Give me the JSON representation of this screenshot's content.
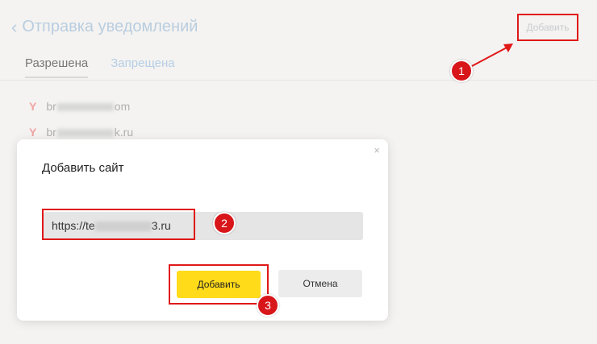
{
  "header": {
    "back_label": "Отправка уведомлений",
    "add_button": "Добавить"
  },
  "tabs": [
    {
      "label": "Разрешена",
      "active": true
    },
    {
      "label": "Запрещена",
      "active": false
    }
  ],
  "sites": [
    {
      "prefix": "br",
      "suffix": "om"
    },
    {
      "prefix": "br",
      "suffix": "k.ru"
    }
  ],
  "modal": {
    "title": "Добавить сайт",
    "close_icon": "×",
    "input_prefix": "https://te",
    "input_suffix": "3.ru",
    "add_button": "Добавить",
    "cancel_button": "Отмена"
  },
  "annotations": [
    "1",
    "2",
    "3"
  ],
  "colors": {
    "accent_yellow": "#ffdb1a",
    "annotation_red": "#e01818",
    "link_blue": "#b5cde6"
  }
}
